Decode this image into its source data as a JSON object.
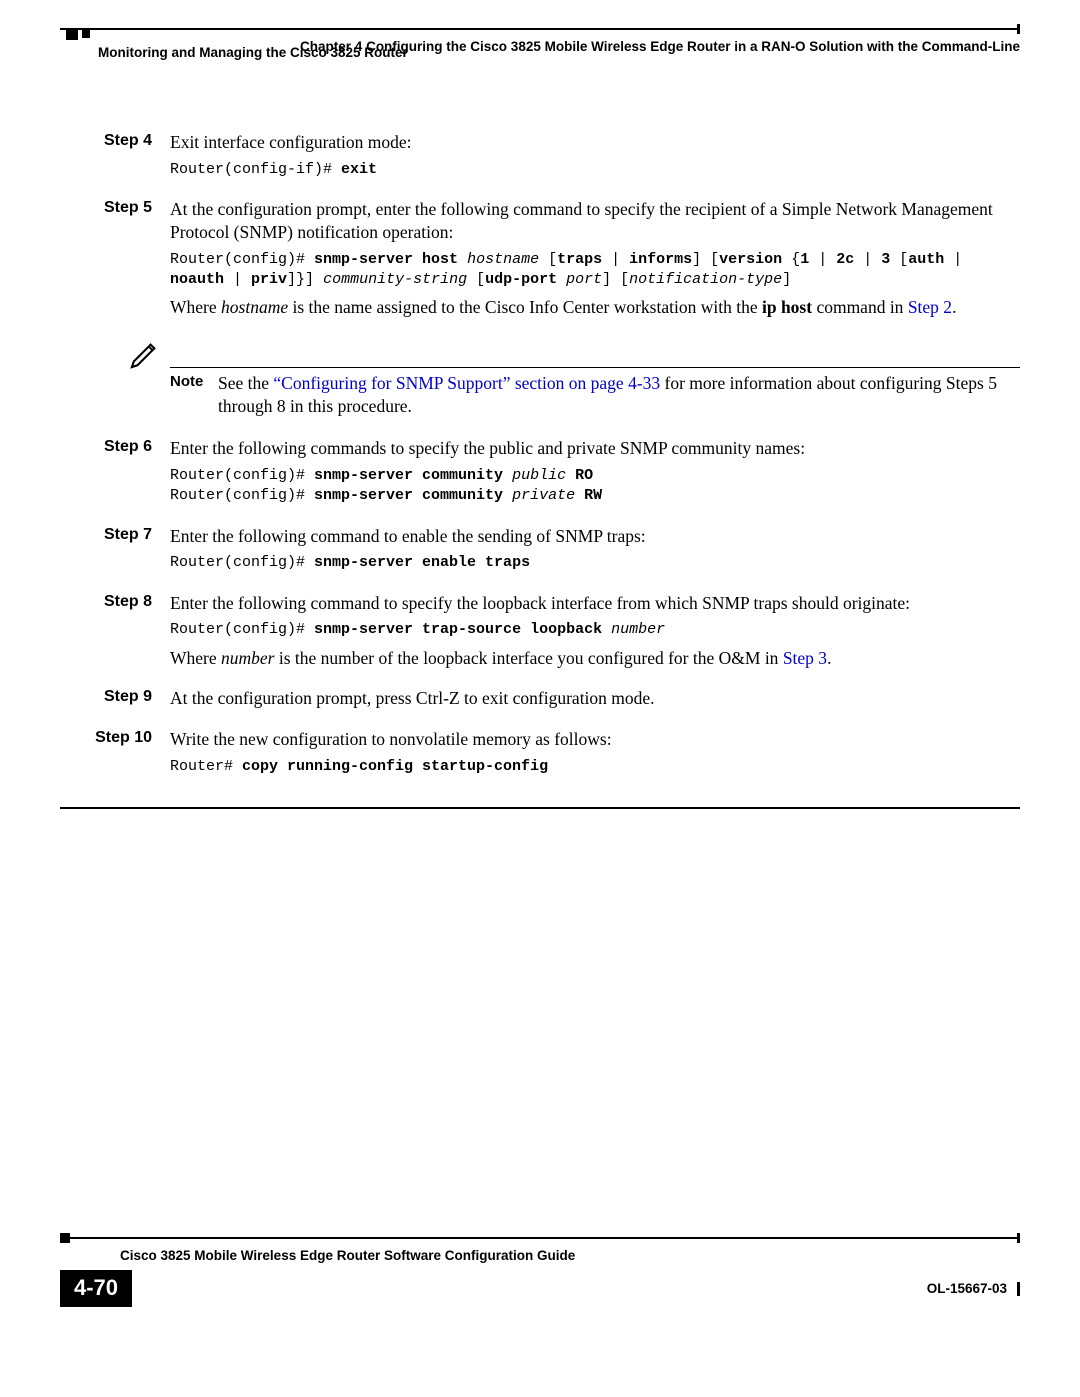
{
  "header": {
    "chapter_line": "Chapter 4    Configuring the Cisco 3825 Mobile Wireless Edge Router in a RAN-O Solution with the Command-Line",
    "section_line": "Monitoring and Managing the Cisco 3825 Router"
  },
  "steps": {
    "s4": {
      "label": "Step 4",
      "text": "Exit interface configuration mode:",
      "code_prompt": "Router(config-if)# ",
      "code_cmd": "exit"
    },
    "s5": {
      "label": "Step 5",
      "text": "At the configuration prompt, enter the following command to specify the recipient of a Simple Network Management Protocol (SNMP) notification operation:",
      "code_prompt": "Router(config)# ",
      "code_p1": "snmp-server host ",
      "code_i1": "hostname",
      "code_p2": " [",
      "code_b2": "traps ",
      "code_p2b": "| ",
      "code_b3": "informs",
      "code_p3": "] [",
      "code_b4": "version ",
      "code_p4": "{",
      "code_b5": "1 ",
      "code_p5": "| ",
      "code_b6": "2c ",
      "code_p6": "| ",
      "code_b7": "3 ",
      "code_p7": "[",
      "code_b8": "auth ",
      "code_p8": "| ",
      "code_b9": "noauth ",
      "code_p9": "| ",
      "code_b10": "priv",
      "code_p10": "]}] ",
      "code_i2": "community-string",
      "code_p11": " [",
      "code_b11": "udp-port ",
      "code_i3": "port",
      "code_p12": "] [",
      "code_i4": "notification-type",
      "code_p13": "]",
      "after_pre": "Where ",
      "after_i": "hostname",
      "after_mid": " is the name assigned to the Cisco Info Center workstation with the ",
      "after_b": "ip host",
      "after_post": " command in ",
      "after_link": "Step 2",
      "after_end": "."
    },
    "note": {
      "label": "Note",
      "pre": "See the ",
      "link": "“Configuring for SNMP Support” section on page 4-33",
      "post": " for more information about configuring Steps 5 through 8 in this procedure."
    },
    "s6": {
      "label": "Step 6",
      "text": "Enter the following commands to specify the public and private SNMP community names:",
      "l1_prompt": "Router(config)# ",
      "l1_cmd": "snmp-server community ",
      "l1_i": "public",
      "l1_b2": " RO",
      "l2_prompt": "Router(config)# ",
      "l2_cmd": "snmp-server community ",
      "l2_i": "private",
      "l2_b2": " RW"
    },
    "s7": {
      "label": "Step 7",
      "text": "Enter the following command to enable the sending of SNMP traps:",
      "prompt": "Router(config)# ",
      "cmd": "snmp-server enable traps"
    },
    "s8": {
      "label": "Step 8",
      "text": "Enter the following command to specify the loopback interface from which SNMP traps should originate:",
      "prompt": "Router(config)# ",
      "cmd": "snmp-server trap-source loopback ",
      "i": "number",
      "after_pre": "Where ",
      "after_i": "number",
      "after_mid": " is the number of the loopback interface you configured for the O&M in ",
      "after_link": "Step 3",
      "after_end": "."
    },
    "s9": {
      "label": "Step 9",
      "text": "At the configuration prompt, press Ctrl-Z to exit configuration mode."
    },
    "s10": {
      "label": "Step 10",
      "text": "Write the new configuration to nonvolatile memory as follows:",
      "prompt": "Router# ",
      "cmd": "copy running-config startup-config"
    }
  },
  "footer": {
    "guide": "Cisco 3825 Mobile Wireless Edge Router Software Configuration Guide",
    "page": "4-70",
    "doc": "OL-15667-03"
  }
}
